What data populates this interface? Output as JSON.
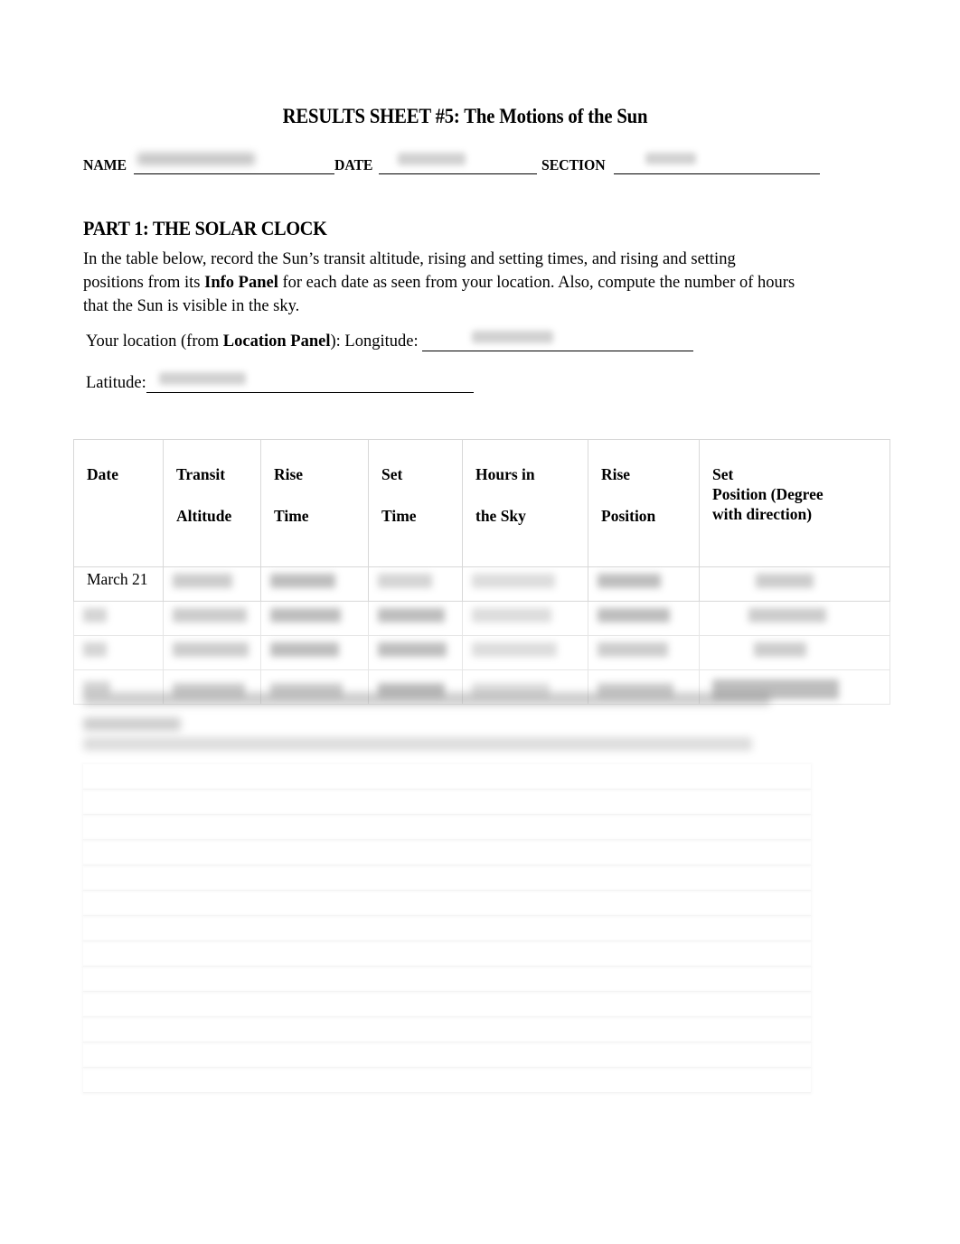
{
  "document": {
    "title": "RESULTS SHEET #5: The Motions of the Sun"
  },
  "id_line": {
    "name_label": "NAME",
    "date_label": "DATE",
    "section_label": "SECTION",
    "name_value": "",
    "date_value": "",
    "section_value": ""
  },
  "part1": {
    "heading": "PART 1: THE SOLAR CLOCK",
    "intro_part1": "In the table below, record the Sun’s transit altitude, rising and setting times, and rising and setting positions from its ",
    "intro_bold": "Info Panel",
    "intro_part2": " for each date as seen from your location. Also, compute the number of hours that the Sun is visible in the sky.",
    "location_prefix": "Your location (from ",
    "location_bold": "Location Panel",
    "location_suffix": "): Longitude: ",
    "longitude_value": "",
    "latitude_label": "Latitude:",
    "latitude_value": ""
  },
  "table": {
    "headers": [
      {
        "line1": "Date",
        "line2": ""
      },
      {
        "line1": "Transit",
        "line2": "Altitude"
      },
      {
        "line1": "Rise",
        "line2": "Time"
      },
      {
        "line1": "Set",
        "line2": "Time"
      },
      {
        "line1": "Hours in",
        "line2": "the Sky"
      },
      {
        "line1": "Rise",
        "line2": "Position"
      },
      {
        "line1": "Set",
        "line2": "Position (Degree",
        "line3": "with direction)"
      }
    ],
    "rows": [
      {
        "date": "March 21",
        "transit_altitude": "",
        "rise_time": "",
        "set_time": "",
        "hours_in_sky": "",
        "rise_position": "",
        "set_position": ""
      },
      {
        "date": "",
        "transit_altitude": "",
        "rise_time": "",
        "set_time": "",
        "hours_in_sky": "",
        "rise_position": "",
        "set_position": ""
      },
      {
        "date": "",
        "transit_altitude": "",
        "rise_time": "",
        "set_time": "",
        "hours_in_sky": "",
        "rise_position": "",
        "set_position": ""
      },
      {
        "date": "",
        "transit_altitude": "",
        "rise_time": "",
        "set_time": "",
        "hours_in_sky": "",
        "rise_position": "",
        "set_position": ""
      }
    ]
  },
  "question": {
    "text": ""
  },
  "answer_area": {
    "line_count": 13
  }
}
